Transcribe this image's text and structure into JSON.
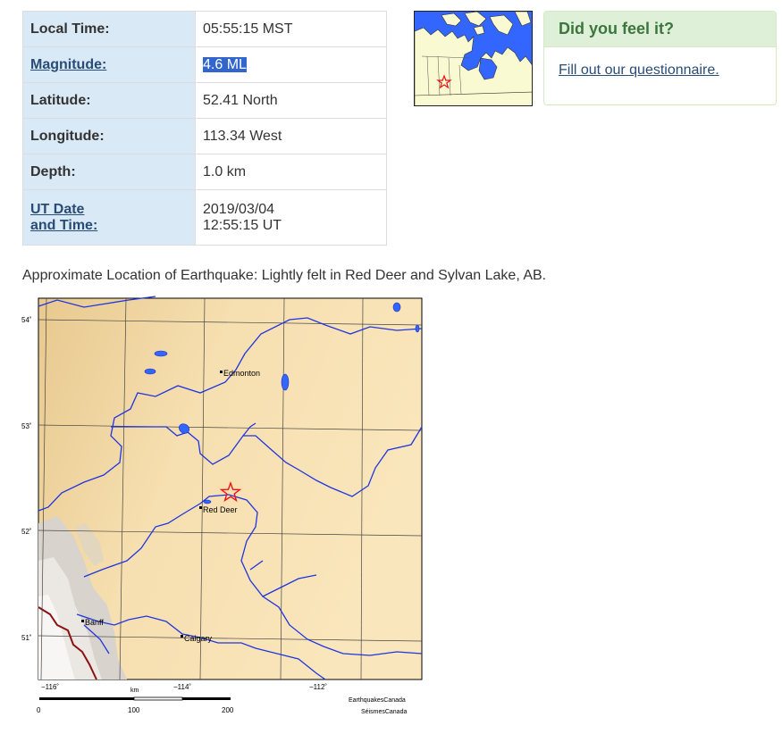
{
  "table": {
    "rows": [
      {
        "label": "Local Time:",
        "value": "05:55:15 MST",
        "link": false
      },
      {
        "label": "Magnitude:",
        "value": "4.6 ML",
        "link": true,
        "selected": true
      },
      {
        "label": "Latitude:",
        "value": "52.41 North",
        "link": false
      },
      {
        "label": "Longitude:",
        "value": "113.34 West",
        "link": false
      },
      {
        "label": "Depth:",
        "value": "1.0 km",
        "link": false
      },
      {
        "label_line1": "UT Date",
        "label_line2": "and Time:",
        "value_line1": "2019/03/04",
        "value_line2": "12:55:15 UT",
        "link": true
      }
    ]
  },
  "feel": {
    "title": "Did you feel it?",
    "link": "Fill out our questionnaire."
  },
  "caption": "Approximate Location of Earthquake: Lightly felt in Red Deer and Sylvan Lake, AB.",
  "map": {
    "lat_labels": [
      "54˚",
      "53˚",
      "52˚",
      "51˚"
    ],
    "lon_labels": [
      "−116˚",
      "−114˚",
      "−112˚"
    ],
    "cities": {
      "edmonton": "Edmonton",
      "red_deer": "Red Deer",
      "banff": "Banff",
      "calgary": "Calgary"
    },
    "scale": {
      "unit": "km",
      "ticks": [
        "0",
        "100",
        "200"
      ]
    },
    "credit_line1": "EarthquakesCanada",
    "credit_line2": "SéismesCanada"
  },
  "colors": {
    "label_bg": "#d9e9f5",
    "link": "#284c76",
    "feel_header_bg": "#dff0d8",
    "feel_header_text": "#3c763d",
    "water": "#3366ff",
    "land": "#f4dcae",
    "epicenter": "#ee1111",
    "border": "#8b1010"
  }
}
